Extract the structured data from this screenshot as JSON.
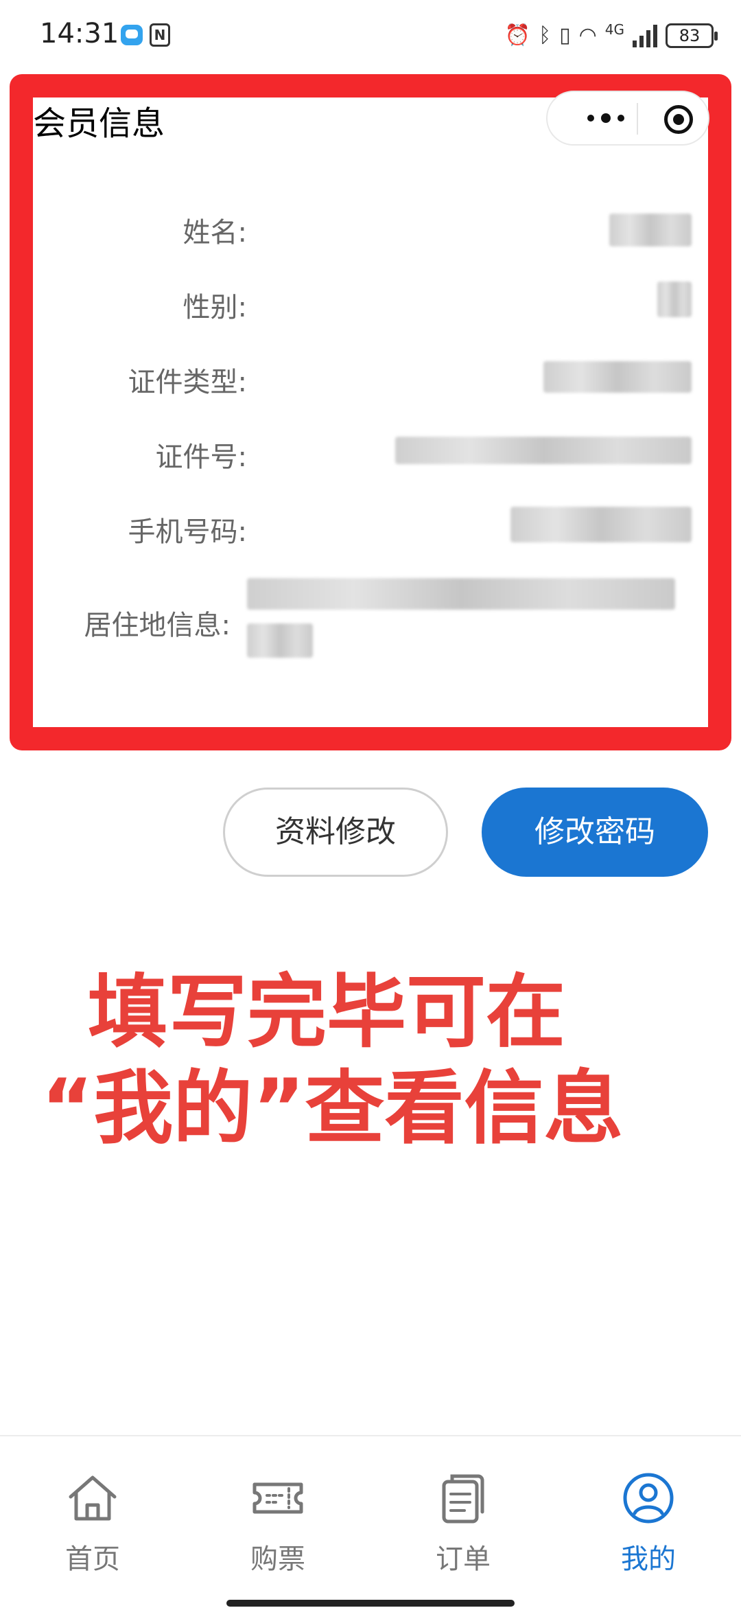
{
  "status_bar": {
    "time": "14:31",
    "network": "4G",
    "battery": "83"
  },
  "header": {
    "title": "会员信息"
  },
  "member_info": {
    "fields": [
      {
        "label": "姓名:"
      },
      {
        "label": "性别:"
      },
      {
        "label": "证件类型:"
      },
      {
        "label": "证件号:"
      },
      {
        "label": "手机号码:"
      },
      {
        "label": "居住地信息:"
      }
    ]
  },
  "actions": {
    "edit_label": "资料修改",
    "password_label": "修改密码"
  },
  "annotation": {
    "line1": "填写完毕可在",
    "line2": "“我的”查看信息"
  },
  "tabs": [
    {
      "label": "首页",
      "icon": "home-icon"
    },
    {
      "label": "购票",
      "icon": "ticket-icon"
    },
    {
      "label": "订单",
      "icon": "order-icon"
    },
    {
      "label": "我的",
      "icon": "user-icon",
      "active": true
    }
  ],
  "colors": {
    "accent": "#1b76d2",
    "annotation_red": "#e8413a",
    "frame_red": "#f3282c"
  }
}
